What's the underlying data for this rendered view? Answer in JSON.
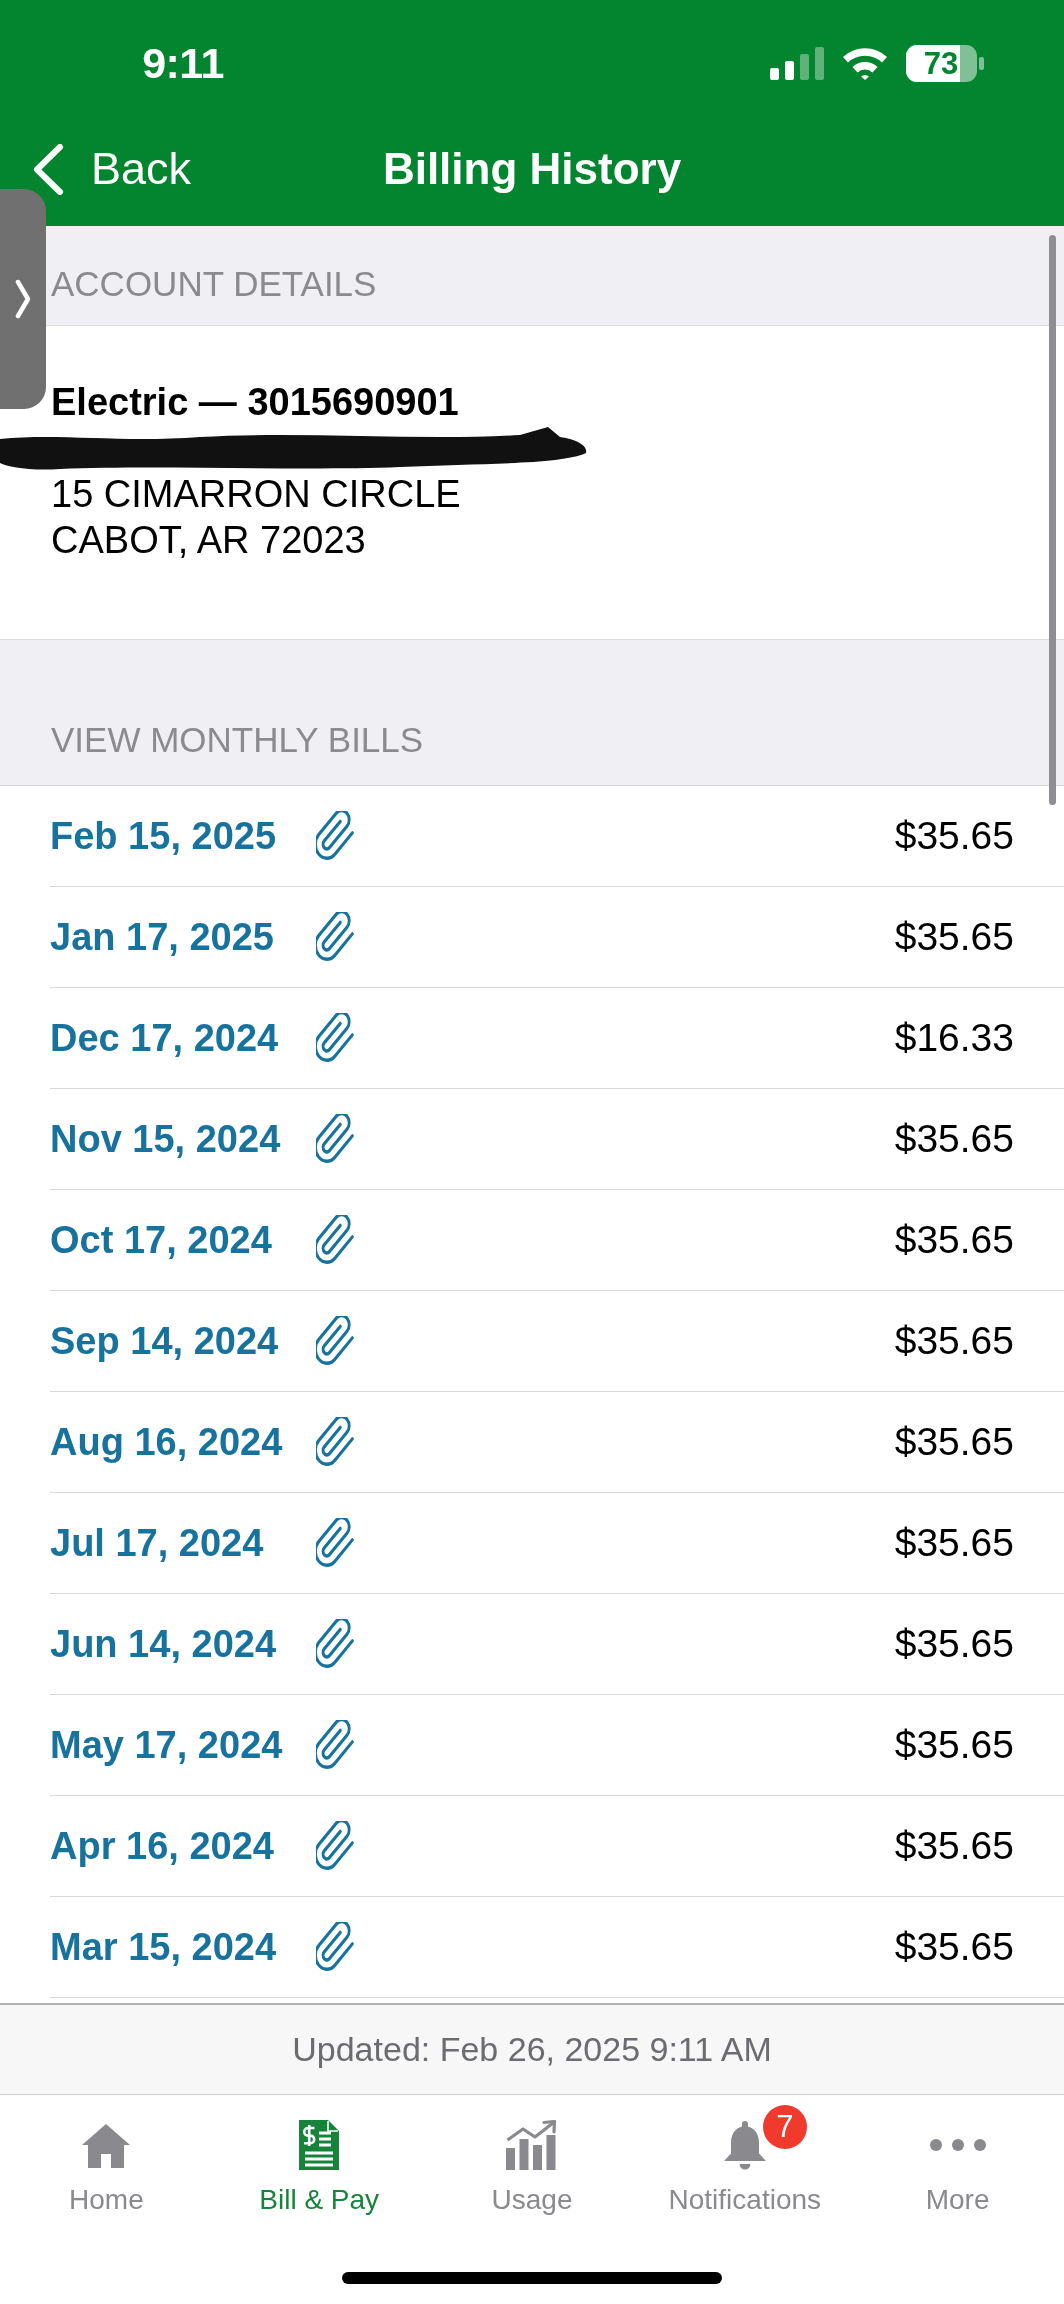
{
  "status_bar": {
    "time": "9:11",
    "battery": "73"
  },
  "nav": {
    "back_label": "Back",
    "title": "Billing History"
  },
  "account_section": {
    "header": "ACCOUNT DETAILS",
    "account_line": "Electric — 3015690901",
    "owner_redacted": true,
    "address_lines": [
      "15 CIMARRON CIRCLE",
      "CABOT, AR 72023"
    ]
  },
  "bills_section": {
    "header": "VIEW MONTHLY BILLS",
    "bills": [
      {
        "date": "Feb 15, 2025",
        "amount": "$35.65",
        "attachment": true
      },
      {
        "date": "Jan 17, 2025",
        "amount": "$35.65",
        "attachment": true
      },
      {
        "date": "Dec 17, 2024",
        "amount": "$16.33",
        "attachment": true
      },
      {
        "date": "Nov 15, 2024",
        "amount": "$35.65",
        "attachment": true
      },
      {
        "date": "Oct 17, 2024",
        "amount": "$35.65",
        "attachment": true
      },
      {
        "date": "Sep 14, 2024",
        "amount": "$35.65",
        "attachment": true
      },
      {
        "date": "Aug 16, 2024",
        "amount": "$35.65",
        "attachment": true
      },
      {
        "date": "Jul 17, 2024",
        "amount": "$35.65",
        "attachment": true
      },
      {
        "date": "Jun 14, 2024",
        "amount": "$35.65",
        "attachment": true
      },
      {
        "date": "May 17, 2024",
        "amount": "$35.65",
        "attachment": true
      },
      {
        "date": "Apr 16, 2024",
        "amount": "$35.65",
        "attachment": true
      },
      {
        "date": "Mar 15, 2024",
        "amount": "$35.65",
        "attachment": true
      }
    ]
  },
  "footer": {
    "updated": "Updated: Feb 26, 2025 9:11 AM"
  },
  "tab_bar": {
    "tabs": [
      {
        "kind": "home",
        "label": "Home",
        "selected": false
      },
      {
        "kind": "bill-pay",
        "label": "Bill & Pay",
        "selected": true
      },
      {
        "kind": "usage",
        "label": "Usage",
        "selected": false
      },
      {
        "kind": "notifications",
        "label": "Notifications",
        "selected": false,
        "badge": "7"
      },
      {
        "kind": "more",
        "label": "More",
        "selected": false
      }
    ]
  }
}
